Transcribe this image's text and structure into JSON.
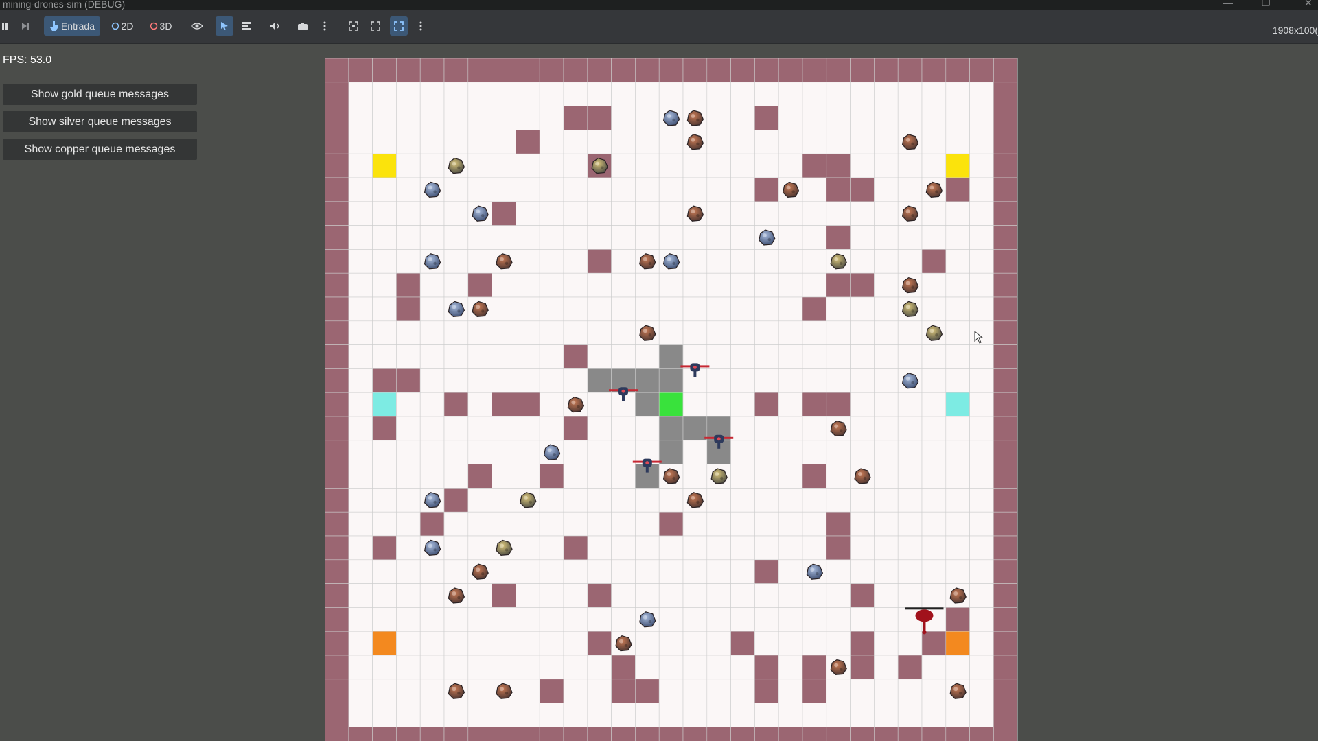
{
  "window": {
    "title": "mining-drones-sim (DEBUG)"
  },
  "toolbar": {
    "input_label": "Entrada",
    "mode_2d_label": "2D",
    "mode_3d_label": "3D",
    "resolution": "1908x100("
  },
  "hud": {
    "fps": "FPS: 53.0",
    "gold_button": "Show gold queue messages",
    "silver_button": "Show silver queue messages",
    "copper_button": "Show copper queue messages"
  },
  "colors": {
    "wall": "#9b6672",
    "floor": "#fbf7f7",
    "path": "#898989",
    "gold_base": "#fbe30c",
    "teal_base": "#7debe3",
    "orange_base": "#f3891f",
    "hub": "#39e23c"
  },
  "map": {
    "columns": 29,
    "rows": 29,
    "walls": [
      [
        10,
        2
      ],
      [
        11,
        2
      ],
      [
        18,
        2
      ],
      [
        8,
        3
      ],
      [
        11,
        4
      ],
      [
        20,
        4
      ],
      [
        21,
        4
      ],
      [
        18,
        5
      ],
      [
        21,
        5
      ],
      [
        22,
        5
      ],
      [
        26,
        5
      ],
      [
        7,
        6
      ],
      [
        21,
        7
      ],
      [
        11,
        8
      ],
      [
        25,
        8
      ],
      [
        3,
        9
      ],
      [
        6,
        9
      ],
      [
        21,
        9
      ],
      [
        22,
        9
      ],
      [
        3,
        10
      ],
      [
        20,
        10
      ],
      [
        10,
        12
      ],
      [
        2,
        13
      ],
      [
        3,
        13
      ],
      [
        5,
        14
      ],
      [
        7,
        14
      ],
      [
        8,
        14
      ],
      [
        18,
        14
      ],
      [
        20,
        14
      ],
      [
        21,
        14
      ],
      [
        2,
        15
      ],
      [
        10,
        15
      ],
      [
        6,
        17
      ],
      [
        9,
        17
      ],
      [
        20,
        17
      ],
      [
        5,
        18
      ],
      [
        4,
        19
      ],
      [
        14,
        19
      ],
      [
        21,
        19
      ],
      [
        2,
        20
      ],
      [
        10,
        20
      ],
      [
        21,
        20
      ],
      [
        18,
        21
      ],
      [
        7,
        22
      ],
      [
        11,
        22
      ],
      [
        22,
        22
      ],
      [
        26,
        23
      ],
      [
        11,
        24
      ],
      [
        17,
        24
      ],
      [
        22,
        24
      ],
      [
        25,
        24
      ],
      [
        12,
        25
      ],
      [
        18,
        25
      ],
      [
        20,
        25
      ],
      [
        22,
        25
      ],
      [
        24,
        25
      ],
      [
        9,
        26
      ],
      [
        12,
        26
      ],
      [
        13,
        26
      ],
      [
        18,
        26
      ],
      [
        20,
        26
      ]
    ],
    "path_cells": [
      [
        14,
        12
      ],
      [
        11,
        13
      ],
      [
        12,
        13
      ],
      [
        13,
        13
      ],
      [
        14,
        13
      ],
      [
        13,
        14
      ],
      [
        14,
        15
      ],
      [
        15,
        15
      ],
      [
        16,
        15
      ],
      [
        14,
        16
      ],
      [
        16,
        16
      ],
      [
        13,
        17
      ]
    ],
    "hub": [
      14,
      14
    ],
    "gold_bases": [
      [
        2,
        4
      ],
      [
        26,
        4
      ]
    ],
    "teal_bases": [
      [
        2,
        14
      ],
      [
        26,
        14
      ]
    ],
    "orange_bases": [
      [
        2,
        24
      ],
      [
        26,
        24
      ]
    ],
    "copper_ore": [
      [
        15,
        2
      ],
      [
        15,
        3
      ],
      [
        24,
        3
      ],
      [
        19,
        5
      ],
      [
        25,
        5
      ],
      [
        15,
        6
      ],
      [
        24,
        6
      ],
      [
        7,
        8
      ],
      [
        13,
        8
      ],
      [
        24,
        9
      ],
      [
        6,
        10
      ],
      [
        13,
        11
      ],
      [
        10,
        14
      ],
      [
        21,
        15
      ],
      [
        14,
        17
      ],
      [
        22,
        17
      ],
      [
        15,
        18
      ],
      [
        6,
        21
      ],
      [
        5,
        22
      ],
      [
        26,
        22
      ],
      [
        12,
        24
      ],
      [
        21,
        25
      ],
      [
        5,
        26
      ],
      [
        7,
        26
      ],
      [
        26,
        26
      ]
    ],
    "silver_ore": [
      [
        14,
        2
      ],
      [
        4,
        5
      ],
      [
        6,
        6
      ],
      [
        18,
        7
      ],
      [
        4,
        8
      ],
      [
        14,
        8
      ],
      [
        5,
        10
      ],
      [
        24,
        13
      ],
      [
        9,
        16
      ],
      [
        4,
        18
      ],
      [
        4,
        20
      ],
      [
        20,
        21
      ],
      [
        13,
        23
      ]
    ],
    "gold_ore": [
      [
        5,
        4
      ],
      [
        11,
        4
      ],
      [
        21,
        8
      ],
      [
        24,
        10
      ],
      [
        25,
        11
      ],
      [
        16,
        17
      ],
      [
        8,
        18
      ],
      [
        7,
        20
      ]
    ],
    "drones": [
      [
        15,
        12.5
      ],
      [
        12,
        13.5
      ],
      [
        16,
        15.5
      ],
      [
        13,
        16.5
      ]
    ],
    "helicopter": [
      25.1,
      23.4
    ]
  }
}
